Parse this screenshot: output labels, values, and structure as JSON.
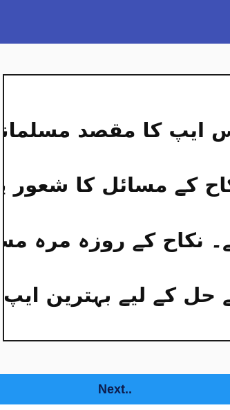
{
  "app_bar": {
    "color": "#3f51b5"
  },
  "intro": {
    "lines": [
      "اس ایپ کا مقصد مسلمانوں میں",
      "نکاح کے مسائل کا شعور پیدا کرنا",
      "ہے۔ نکاح کے روزہ مرہ مسائل",
      "کے حل کے لیے بہترین ایپ"
    ]
  },
  "footer": {
    "next_label": "Next..",
    "accent": "#2196f3"
  }
}
